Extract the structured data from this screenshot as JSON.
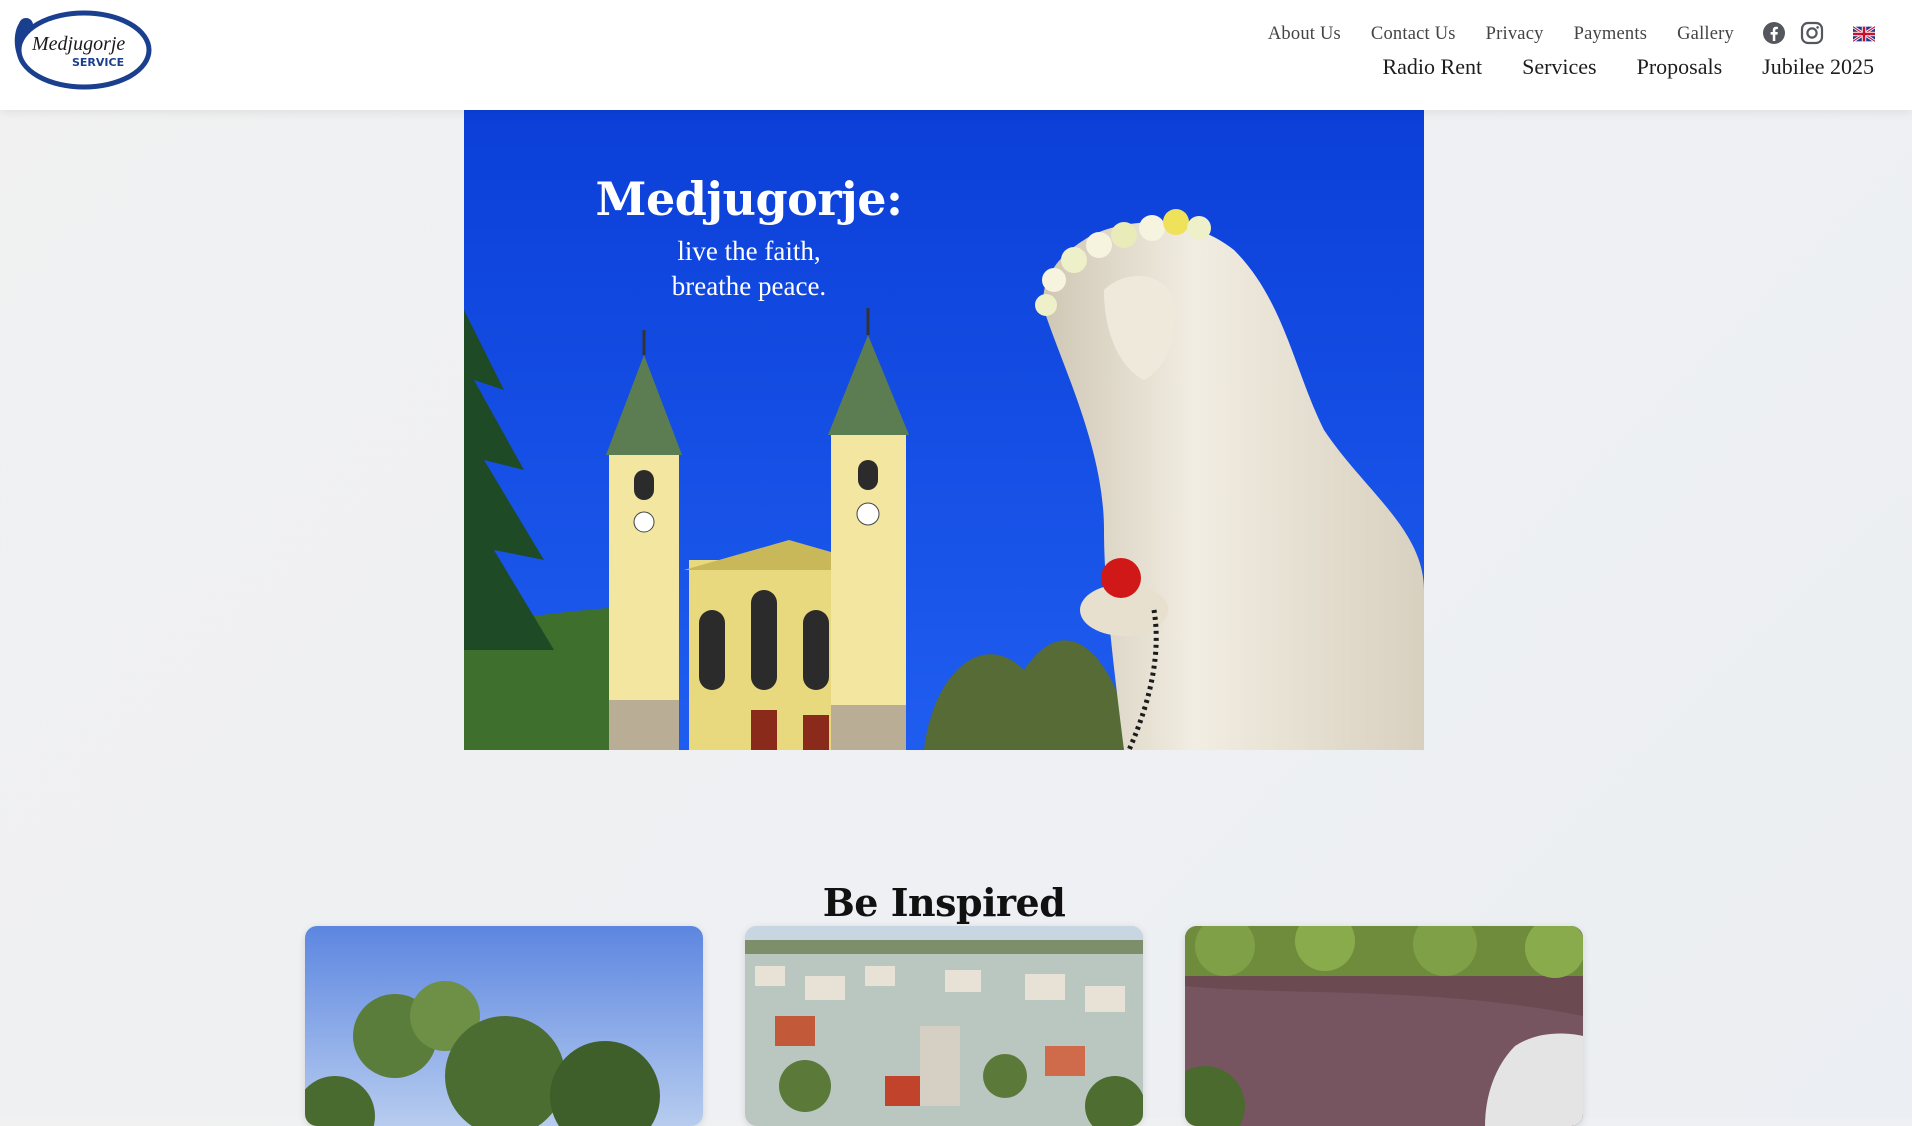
{
  "header": {
    "logo_text": "Medjugorje",
    "logo_sub": "SERVICE",
    "top_links": [
      "About Us",
      "Contact Us",
      "Privacy",
      "Payments",
      "Gallery"
    ],
    "main_nav": [
      "Radio Rent",
      "Services",
      "Proposals",
      "Jubilee 2025"
    ],
    "social": [
      "facebook-icon",
      "instagram-icon"
    ],
    "language_flag": "uk-flag-icon"
  },
  "hero": {
    "title": "Medjugorje:",
    "subtitle_line1": "live the faith,",
    "subtitle_line2": "breathe peace."
  },
  "section": {
    "title": "Be Inspired"
  },
  "colors": {
    "brand_blue": "#1b3f8f",
    "sky_blue": "#0a3fd6",
    "header_bg": "#ffffff",
    "page_bg": "#eff0f3"
  }
}
